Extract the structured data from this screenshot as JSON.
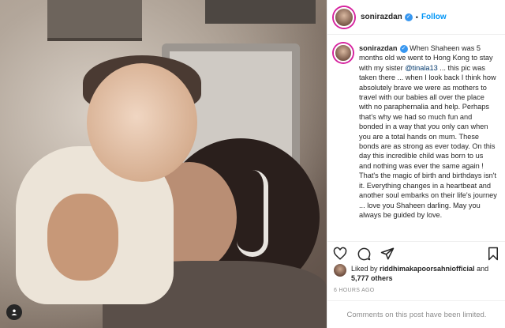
{
  "post": {
    "username": "sonirazdan",
    "follow_label": "Follow",
    "separator": "•",
    "caption_username": "sonirazdan",
    "caption_part1": " When Shaheen was 5 months old we went to Hong Kong to stay with my sister ",
    "mention": "@tinala13",
    "caption_part2": " ... this pic was taken there ... when I look back I think how absolutely brave we were as mothers to travel with our babies all over the place with no paraphernalia and help. Perhaps that's why we had so much fun and bonded in a way that you only can when you are a total hands on mum. These bonds are as strong as ever today. On this day this incredible child was born to us and nothing was ever the same again ! That's the magic of birth and birthdays isn't it. Everything changes in a heartbeat and another soul embarks on their life's journey ... love you Shaheen darling. May you always be guided by love.",
    "liked_by_prefix": "Liked by ",
    "liked_by_user": "riddhimakapoorsahniofficial",
    "liked_by_and": " and",
    "likes_count": "5,777 others",
    "time_ago": "6 HOURS AGO",
    "comments_notice": "Comments on this post have been limited."
  },
  "icons": {
    "verified": "verified-badge-icon",
    "like": "heart-icon",
    "comment": "comment-icon",
    "share": "paper-plane-icon",
    "save": "bookmark-icon",
    "accessibility": "user-tag-icon"
  },
  "colors": {
    "follow": "#0095f6",
    "verified": "#3897f0",
    "muted": "#8e8e8e"
  }
}
